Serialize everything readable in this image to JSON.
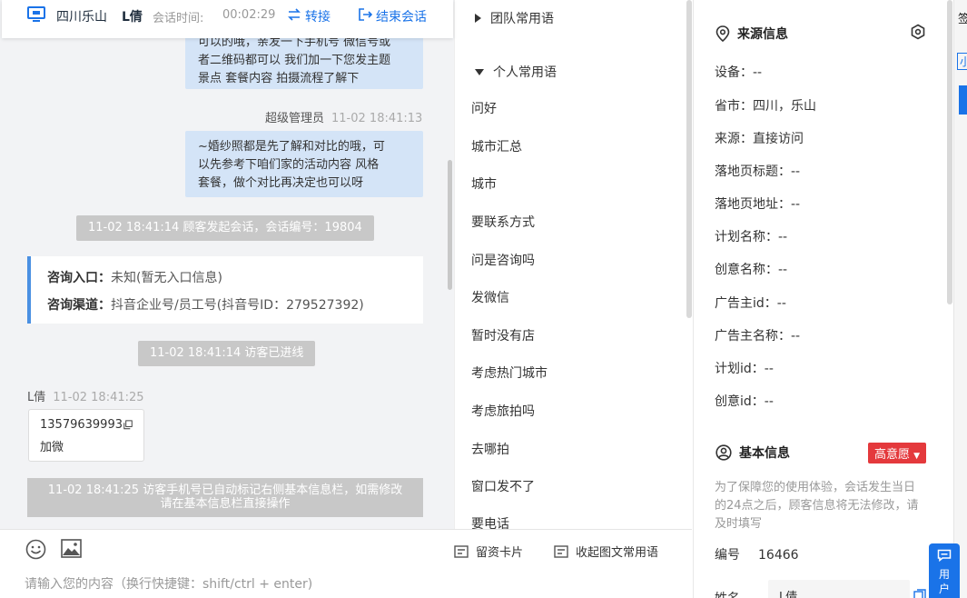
{
  "header": {
    "location": "四川乐山",
    "visitor_name": "L倩",
    "duration_label": "会话时间:",
    "duration_value": "00:02:29",
    "transfer_label": "转接",
    "end_label": "结束会话"
  },
  "messages": {
    "agent_msg_1_lines": [
      "可以的哦，亲发一下手机号 微信号或",
      "者二维码都可以 我们加一下您发主题",
      "景点 套餐内容 拍摄流程了解下"
    ],
    "agent_sender": "超级管理员",
    "agent_time": "11-02 18:41:13",
    "agent_msg_2_lines": [
      "~婚纱照都是先了解和对比的哦，可",
      "以先参考下咱们家的活动内容 风格",
      "套餐，做个对比再决定也可以呀"
    ],
    "sys_session_start": "11-02 18:41:14 顾客发起会话，会话编号：19804",
    "entry_label": "咨询入口：",
    "entry_value": "未知(暂无入口信息)",
    "channel_label": "咨询渠道：",
    "channel_value": "抖音企业号/员工号(抖音号ID：279527392)",
    "sys_visitor_in": "11-02 18:41:14 访客已进线",
    "visitor_sender": "L倩",
    "visitor_time": "11-02 18:41:25",
    "visitor_phone": "13579639993",
    "visitor_text": "加微",
    "sys_auto_mark_lines": [
      "11-02 18:41:25 访客手机号已自动标记右侧基本信息栏，如需修改",
      "请在基本信息栏直接操作"
    ]
  },
  "composer": {
    "card_label": "留资卡片",
    "collapse_label": "收起图文常用语",
    "placeholder": "请输入您的内容（换行快捷键：shift/ctrl + enter)"
  },
  "phrases": {
    "team_group": "团队常用语",
    "personal_group": "个人常用语",
    "items": [
      "问好",
      "城市汇总",
      "城市",
      "要联系方式",
      "问是咨询吗",
      "发微信",
      "暂时没有店",
      "考虑热门城市",
      "考虑旅拍吗",
      "去哪拍",
      "窗口发不了",
      "要电话"
    ]
  },
  "source_info": {
    "title": "来源信息",
    "fields": [
      "设备：--",
      "省市：四川，乐山",
      "来源：直接访问",
      "落地页标题：--",
      "落地页地址：--",
      "计划名称：--",
      "创意名称：--",
      "广告主id：--",
      "广告主名称：--",
      "计划id：--",
      "创意id：--"
    ]
  },
  "basic_info": {
    "title": "基本信息",
    "intent": "高意愿",
    "note": "为了保障您的使用体验，会话发生当日的24点之后，顾客信息将无法修改，请及时填写",
    "id_label": "编号",
    "id_value": "16466",
    "name_label": "姓名",
    "name_value": "L倩"
  },
  "edge": {
    "top_text": "签",
    "tab_text": "小",
    "float_label": "用户"
  },
  "colors": {
    "accent": "#1a73e8",
    "agent_bubble": "#d4e4f7",
    "system_pill": "#c8c8c8",
    "intent_red": "#e4393c"
  }
}
